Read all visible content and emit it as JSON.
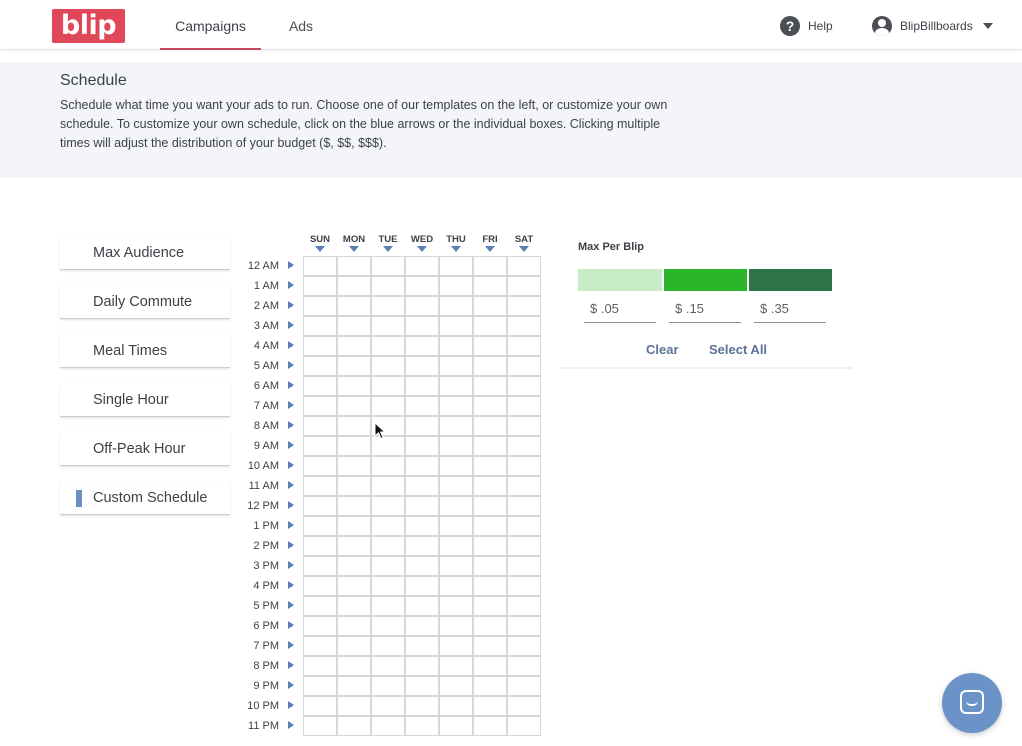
{
  "nav": {
    "logo_text": "blip",
    "tabs": [
      {
        "label": "Campaigns",
        "active": true
      },
      {
        "label": "Ads",
        "active": false
      }
    ],
    "help_label": "Help",
    "account_name": "BlipBillboards"
  },
  "schedule": {
    "title": "Schedule",
    "description": "Schedule what time you want your ads to run. Choose one of our templates on the left, or customize your own schedule. To customize your own schedule, click on the blue arrows or the individual boxes. Clicking multiple times will adjust the distribution of your budget ($, $$, $$$)."
  },
  "templates": [
    {
      "label": "Max Audience",
      "selected": false
    },
    {
      "label": "Daily Commute",
      "selected": false
    },
    {
      "label": "Meal Times",
      "selected": false
    },
    {
      "label": "Single Hour",
      "selected": false
    },
    {
      "label": "Off-Peak Hour",
      "selected": false
    },
    {
      "label": "Custom Schedule",
      "selected": true
    }
  ],
  "grid": {
    "days": [
      "SUN",
      "MON",
      "TUE",
      "WED",
      "THU",
      "FRI",
      "SAT"
    ],
    "hours": [
      "12 AM",
      "1 AM",
      "2 AM",
      "3 AM",
      "4 AM",
      "5 AM",
      "6 AM",
      "7 AM",
      "8 AM",
      "9 AM",
      "10 AM",
      "11 AM",
      "12 PM",
      "1 PM",
      "2 PM",
      "3 PM",
      "4 PM",
      "5 PM",
      "6 PM",
      "7 PM",
      "8 PM",
      "9 PM",
      "10 PM",
      "11 PM"
    ]
  },
  "pricing": {
    "label": "Max Per Blip",
    "tiers": [
      {
        "color": "#c8ecc8",
        "price": "$ .05"
      },
      {
        "color": "#2ab52a",
        "price": "$ .15"
      },
      {
        "color": "#2d7549",
        "price": "$ .35"
      }
    ],
    "clear_label": "Clear",
    "select_all_label": "Select All"
  },
  "colors": {
    "brand": "#e0485a",
    "accent": "#6b8fbf",
    "arrow": "#5b7fb3"
  }
}
